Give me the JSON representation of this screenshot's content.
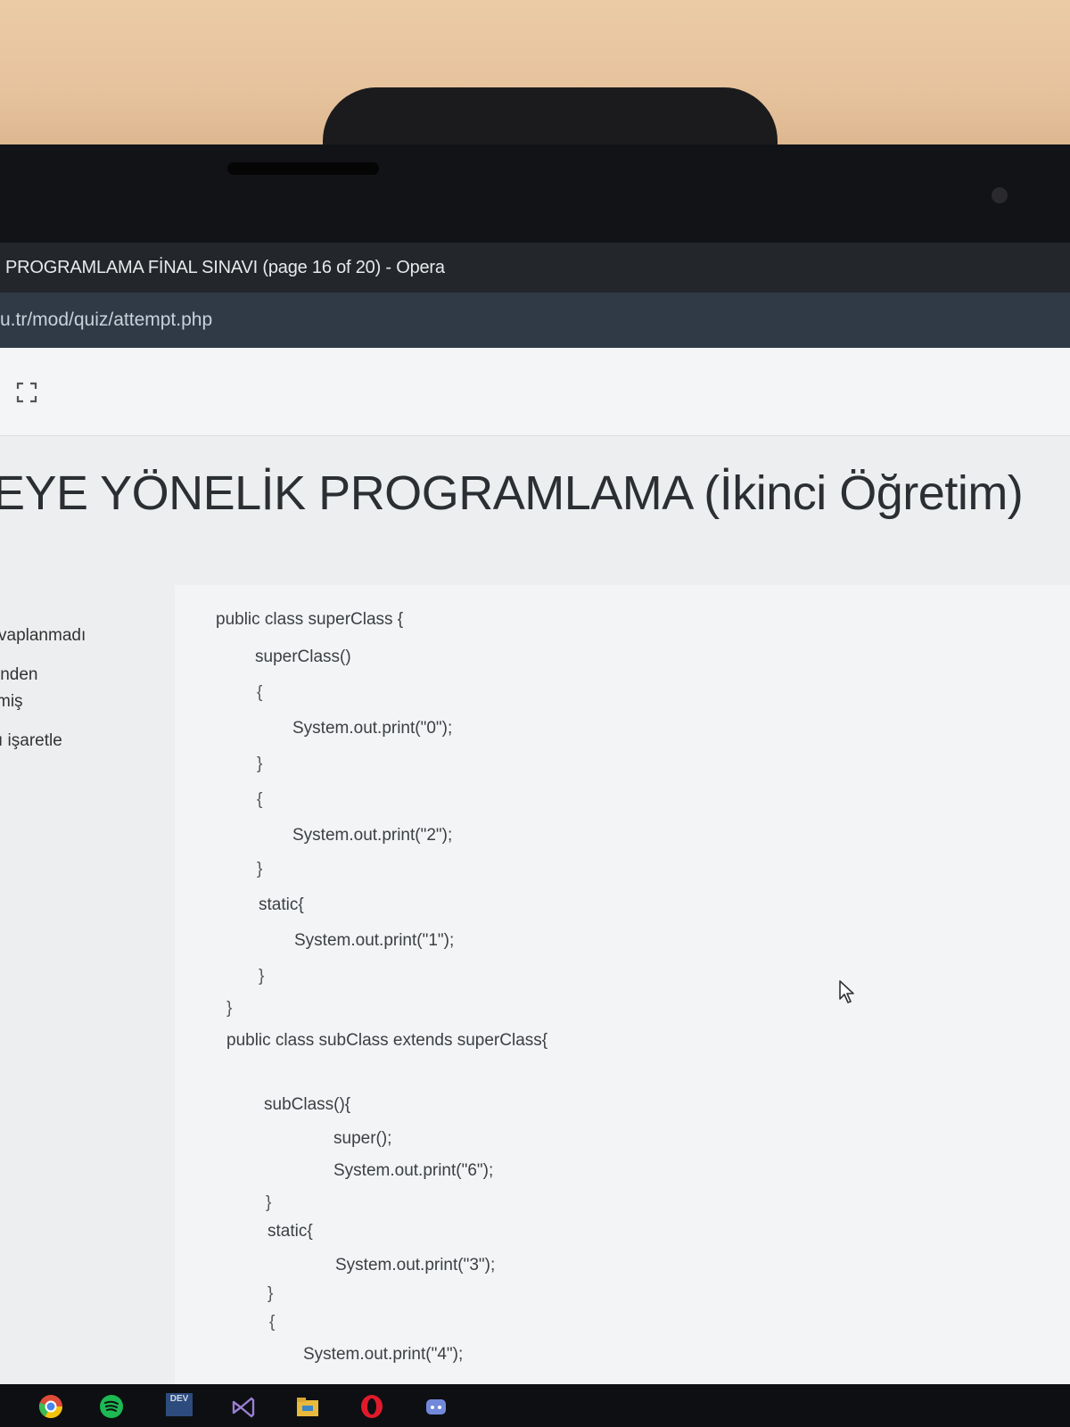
{
  "browser": {
    "window_title": "PROGRAMLAMA FİNAL SINAVI (page 16 of 20) - Opera",
    "url": "u.tr/mod/quiz/attempt.php"
  },
  "page": {
    "title": "EYE YÖNELİK PROGRAMLAMA (İkinci Öğretim)"
  },
  "question_info": {
    "status": "vaplanmadı",
    "grade_line1": "inden",
    "grade_line2": "miş",
    "flag_label": "ı işaretle"
  },
  "code_lines": [
    "public class superClass {",
    "superClass()",
    "{",
    "System.out.print(\"0\");",
    "}",
    "{",
    "System.out.print(\"2\");",
    "}",
    "static{",
    "System.out.print(\"1\");",
    "}",
    "}",
    "public class subClass extends superClass{",
    "subClass(){",
    "super();",
    "System.out.print(\"6\");",
    "}",
    "static{",
    "System.out.print(\"3\");",
    "}",
    "{",
    "System.out.print(\"4\");"
  ],
  "taskbar": {
    "icons": [
      "chrome-icon",
      "spotify-icon",
      "devc-icon",
      "visual-studio-icon",
      "file-explorer-icon",
      "opera-icon",
      "discord-icon"
    ],
    "dev_label": "DEV"
  },
  "colors": {
    "titlebar": "#23272c",
    "addressbar": "#2f3a46",
    "page_bg": "#eceeef",
    "code_text": "#3b3f44"
  }
}
